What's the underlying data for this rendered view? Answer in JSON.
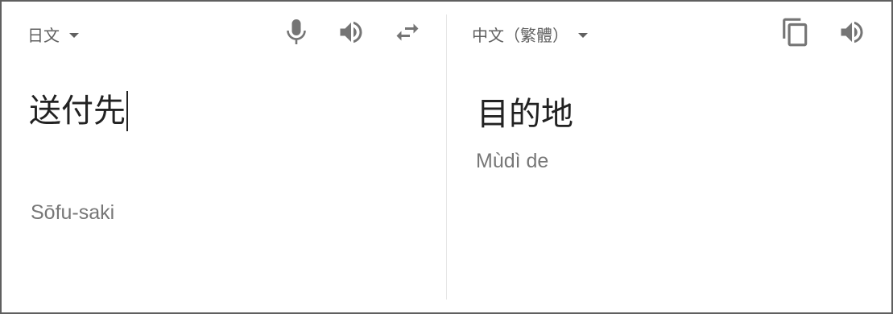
{
  "source": {
    "language": "日文",
    "text": "送付先",
    "romanization": "Sōfu-saki"
  },
  "target": {
    "language": "中文（繁體）",
    "text": "目的地",
    "romanization": "Mùdì de"
  },
  "icons": {
    "microphone": "microphone-icon",
    "speaker": "speaker-icon",
    "swap": "swap-languages-icon",
    "copy": "copy-icon",
    "dropdown": "chevron-down-icon"
  },
  "colors": {
    "icon": "#757575",
    "text": "#222222",
    "secondary_text": "#777777",
    "border": "#5f5f5f",
    "divider": "#e6e6e6"
  }
}
